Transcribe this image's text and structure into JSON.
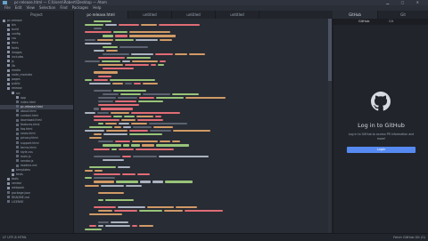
{
  "window": {
    "title": "pc-release.html — C:\\Users\\Robert\\Desktop — Atom"
  },
  "menu": [
    "File",
    "Edit",
    "View",
    "Selection",
    "Find",
    "Packages",
    "Help"
  ],
  "tabs": [
    {
      "label": "Project",
      "active": false
    },
    {
      "label": "pc-release.html",
      "active": true
    },
    {
      "label": "untitled",
      "active": false
    },
    {
      "label": "untitled",
      "active": false
    },
    {
      "label": "untitled",
      "active": false
    },
    {
      "label": "GitHub",
      "active": true
    },
    {
      "label": "Git",
      "active": false
    }
  ],
  "tree": {
    "items": [
      {
        "label": "pc-release",
        "depth": 0,
        "kind": "folder"
      },
      {
        "label": "bin",
        "depth": 1,
        "kind": "folder"
      },
      {
        "label": "build",
        "depth": 1,
        "kind": "folder"
      },
      {
        "label": "config",
        "depth": 1,
        "kind": "folder"
      },
      {
        "label": "css",
        "depth": 1,
        "kind": "folder"
      },
      {
        "label": "docs",
        "depth": 1,
        "kind": "folder"
      },
      {
        "label": "fonts",
        "depth": 1,
        "kind": "folder"
      },
      {
        "label": "images",
        "depth": 1,
        "kind": "folder"
      },
      {
        "label": "includes",
        "depth": 1,
        "kind": "folder"
      },
      {
        "label": "js",
        "depth": 1,
        "kind": "folder"
      },
      {
        "label": "lib",
        "depth": 1,
        "kind": "folder"
      },
      {
        "label": "media",
        "depth": 1,
        "kind": "folder"
      },
      {
        "label": "node_modules",
        "depth": 1,
        "kind": "folder"
      },
      {
        "label": "pages",
        "depth": 1,
        "kind": "folder"
      },
      {
        "label": "public",
        "depth": 1,
        "kind": "folder"
      },
      {
        "label": "release",
        "depth": 1,
        "kind": "folder"
      },
      {
        "label": "src",
        "depth": 2,
        "kind": "folder"
      },
      {
        "label": "app",
        "depth": 3,
        "kind": "folder"
      },
      {
        "label": "index.html",
        "depth": 3,
        "kind": "file"
      },
      {
        "label": "pc-release.html",
        "depth": 3,
        "kind": "file",
        "selected": true
      },
      {
        "label": "about.html",
        "depth": 3,
        "kind": "file"
      },
      {
        "label": "contact.html",
        "depth": 3,
        "kind": "file"
      },
      {
        "label": "download.html",
        "depth": 3,
        "kind": "file"
      },
      {
        "label": "features.html",
        "depth": 3,
        "kind": "file"
      },
      {
        "label": "faq.html",
        "depth": 3,
        "kind": "file"
      },
      {
        "label": "news.html",
        "depth": 3,
        "kind": "file"
      },
      {
        "label": "privacy.html",
        "depth": 3,
        "kind": "file"
      },
      {
        "label": "support.html",
        "depth": 3,
        "kind": "file"
      },
      {
        "label": "terms.html",
        "depth": 3,
        "kind": "file"
      },
      {
        "label": "style.css",
        "depth": 3,
        "kind": "file"
      },
      {
        "label": "main.js",
        "depth": 3,
        "kind": "file"
      },
      {
        "label": "vendor.js",
        "depth": 3,
        "kind": "file"
      },
      {
        "label": "readme.md",
        "depth": 3,
        "kind": "file"
      },
      {
        "label": "templates",
        "depth": 2,
        "kind": "folder"
      },
      {
        "label": "tests",
        "depth": 2,
        "kind": "folder"
      },
      {
        "label": "tools",
        "depth": 1,
        "kind": "folder"
      },
      {
        "label": "vendor",
        "depth": 1,
        "kind": "folder"
      },
      {
        "label": "webpack",
        "depth": 1,
        "kind": "folder"
      },
      {
        "label": "package.json",
        "depth": 1,
        "kind": "file"
      },
      {
        "label": "README.md",
        "depth": 1,
        "kind": "file"
      },
      {
        "label": "LICENSE",
        "depth": 1,
        "kind": "file"
      }
    ]
  },
  "github": {
    "tab_github": "GitHub",
    "tab_git": "Git",
    "title": "Log in to GitHub",
    "description": "Log in to GitHub to access PR information and more!",
    "login_label": "Login"
  },
  "status": {
    "left": "LF  UTF-8  HTML",
    "right": "Fetch  GitHub  Git (0)"
  },
  "colors": {
    "background": "#1e2127",
    "editor": "#282c34",
    "accent_button": "#568af2",
    "syntax_tag": "#e06c75",
    "syntax_attr": "#d19a66",
    "syntax_string": "#98c379",
    "syntax_text": "#abb2bf",
    "syntax_comment": "#5c6370"
  }
}
